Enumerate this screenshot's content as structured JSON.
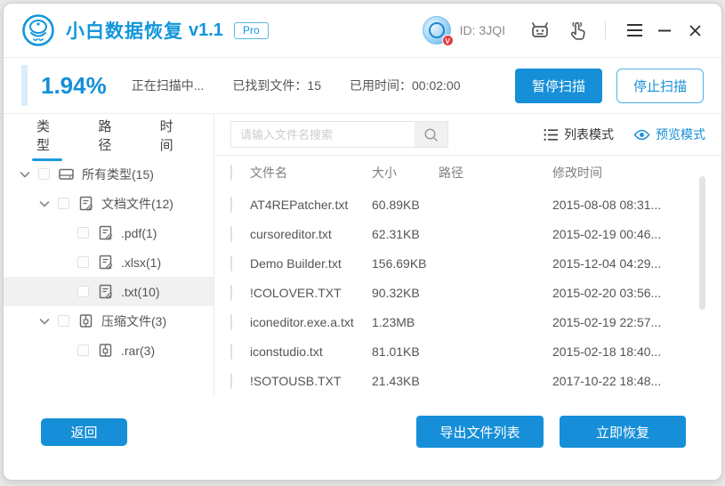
{
  "window": {
    "title": "小白数据恢复",
    "version": "v1.1",
    "badge": "Pro",
    "user_id": "ID: 3JQI"
  },
  "scan": {
    "progress": "1.94%",
    "status": "正在扫描中...",
    "found_label": "已找到文件：",
    "found_count": "15",
    "time_label": "已用时间：",
    "time_value": "00:02:00",
    "pause_button": "暂停扫描",
    "stop_button": "停止扫描"
  },
  "sidebar": {
    "tabs": [
      {
        "label": "类型",
        "active": true
      },
      {
        "label": "路径",
        "active": false
      },
      {
        "label": "时间",
        "active": false
      }
    ],
    "tree": [
      {
        "label": "所有类型(15)",
        "icon": "drive",
        "level": 0,
        "expandable": true,
        "selected": false
      },
      {
        "label": "文档文件(12)",
        "icon": "doc",
        "level": 1,
        "expandable": true,
        "selected": false
      },
      {
        "label": ".pdf(1)",
        "icon": "doc",
        "level": 2,
        "expandable": false,
        "selected": false
      },
      {
        "label": ".xlsx(1)",
        "icon": "doc",
        "level": 2,
        "expandable": false,
        "selected": false
      },
      {
        "label": ".txt(10)",
        "icon": "doc",
        "level": 2,
        "expandable": false,
        "selected": true
      },
      {
        "label": "压缩文件(3)",
        "icon": "zip",
        "level": 1,
        "expandable": true,
        "selected": false
      },
      {
        "label": ".rar(3)",
        "icon": "zip",
        "level": 2,
        "expandable": false,
        "selected": false
      }
    ]
  },
  "toolbar": {
    "search_placeholder": "请输入文件名搜索",
    "list_mode": "列表模式",
    "preview_mode": "预览模式"
  },
  "table": {
    "headers": {
      "name": "文件名",
      "size": "大小",
      "path": "路径",
      "modified": "修改时间"
    },
    "rows": [
      {
        "name": "AT4REPatcher.txt",
        "size": "60.89KB",
        "path": "",
        "modified": "2015-08-08 08:31..."
      },
      {
        "name": "cursoreditor.txt",
        "size": "62.31KB",
        "path": "",
        "modified": "2015-02-19 00:46..."
      },
      {
        "name": "Demo Builder.txt",
        "size": "156.69KB",
        "path": "",
        "modified": "2015-12-04 04:29..."
      },
      {
        "name": "!COLOVER.TXT",
        "size": "90.32KB",
        "path": "",
        "modified": "2015-02-20 03:56..."
      },
      {
        "name": "iconeditor.exe.a.txt",
        "size": "1.23MB",
        "path": "",
        "modified": "2015-02-19 22:57..."
      },
      {
        "name": "iconstudio.txt",
        "size": "81.01KB",
        "path": "",
        "modified": "2015-02-18 18:40..."
      },
      {
        "name": "!SOTOUSB.TXT",
        "size": "21.43KB",
        "path": "",
        "modified": "2017-10-22 18:48..."
      }
    ]
  },
  "footer": {
    "back_button": "返回",
    "export_button": "导出文件列表",
    "recover_button": "立即恢复"
  },
  "colors": {
    "brand_blue": "#1296db",
    "button_blue": "#168fd8",
    "accent_light_blue": "#d9ecfa",
    "badge_red": "#e6393c",
    "selected_row_gray": "#f1f1f1"
  }
}
